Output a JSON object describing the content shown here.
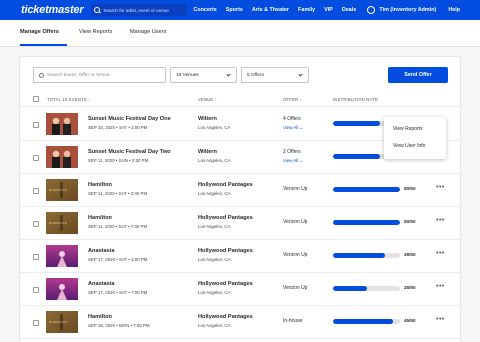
{
  "nav": {
    "logo": "ticketmaster",
    "search_placeholder": "Search for artist, event or venue",
    "links": [
      "Concerts",
      "Sports",
      "Arts & Theater",
      "Family",
      "VIP",
      "Deals"
    ],
    "user": "Tim (Inventory Admin)",
    "help": "Help"
  },
  "tabs": [
    "Manage Offers",
    "View Reports",
    "Manage Users"
  ],
  "filters": {
    "search_placeholder": "Search Event, Offer or Venue",
    "venues": "16 Venues",
    "offers": "5 Offers",
    "send_label": "Send Offer"
  },
  "table": {
    "headers": {
      "events": "TOTAL 15 EVENTS",
      "venue": "VENUE",
      "offer": "OFFER",
      "distribution": "DISTRIBUTION RATE"
    },
    "rows": [
      {
        "name": "Sunset Music Festival Day One",
        "date": "SEP 10, 2020 • SAT • 2:00 PM",
        "venue": "Wiltern",
        "city": "Los Angeles, CA",
        "offer": "4 Offers",
        "view_all": "View All",
        "progress": 0.7,
        "ratio": "",
        "thumb": "festival"
      },
      {
        "name": "Sunset Music Festival Day Two",
        "date": "SEP 11, 2020 • SUN • 2:00 PM",
        "venue": "Wiltern",
        "city": "Los Angeles, CA",
        "offer": "2 Offers",
        "view_all": "View All",
        "progress": 0.7,
        "ratio": "",
        "thumb": "festival"
      },
      {
        "name": "Hamilton",
        "date": "SEP 11, 2020 • SAT • 3:00 PM",
        "venue": "Hollywood Pantages",
        "city": "Los Angeles, CA",
        "offer": "Verizon Up",
        "view_all": "",
        "progress": 1.0,
        "ratio": "50/50",
        "thumb": "hamilton"
      },
      {
        "name": "Hamilton",
        "date": "SEP 11, 2020 • SAT • 7:00 PM",
        "venue": "Hollywood Pantages",
        "city": "Los Angeles, CA",
        "offer": "Verizon Up",
        "view_all": "",
        "progress": 1.0,
        "ratio": "50/50",
        "thumb": "hamilton"
      },
      {
        "name": "Anastasia",
        "date": "SEP 17, 2020 • SAT • 2:00 PM",
        "venue": "Hollywood Pantages",
        "city": "Los Angeles, CA",
        "offer": "Verizon Up",
        "view_all": "",
        "progress": 0.78,
        "ratio": "39/50",
        "thumb": "anastasia"
      },
      {
        "name": "Anastasia",
        "date": "SEP 17, 2020 • SAT • 7:00 PM",
        "venue": "Hollywood Pantages",
        "city": "Los Angeles, CA",
        "offer": "Verizon Up",
        "view_all": "",
        "progress": 0.5,
        "ratio": "25/50",
        "thumb": "anastasia"
      },
      {
        "name": "Hamilton",
        "date": "SEP 18, 2020 • MON • 7:00 PM",
        "venue": "Hollywood Pantages",
        "city": "Los Angeles, CA",
        "offer": "In-house",
        "view_all": "",
        "progress": 0.9,
        "ratio": "45/50",
        "thumb": "hamilton"
      }
    ]
  },
  "menu": [
    "View Reports",
    "View User Info"
  ],
  "thumb_text": "HAMILTON",
  "colors": {
    "brand": "#024ddf",
    "festival": "#a9503c",
    "hamilton": "#6b4a22",
    "anastasia": "#5a1d72"
  }
}
